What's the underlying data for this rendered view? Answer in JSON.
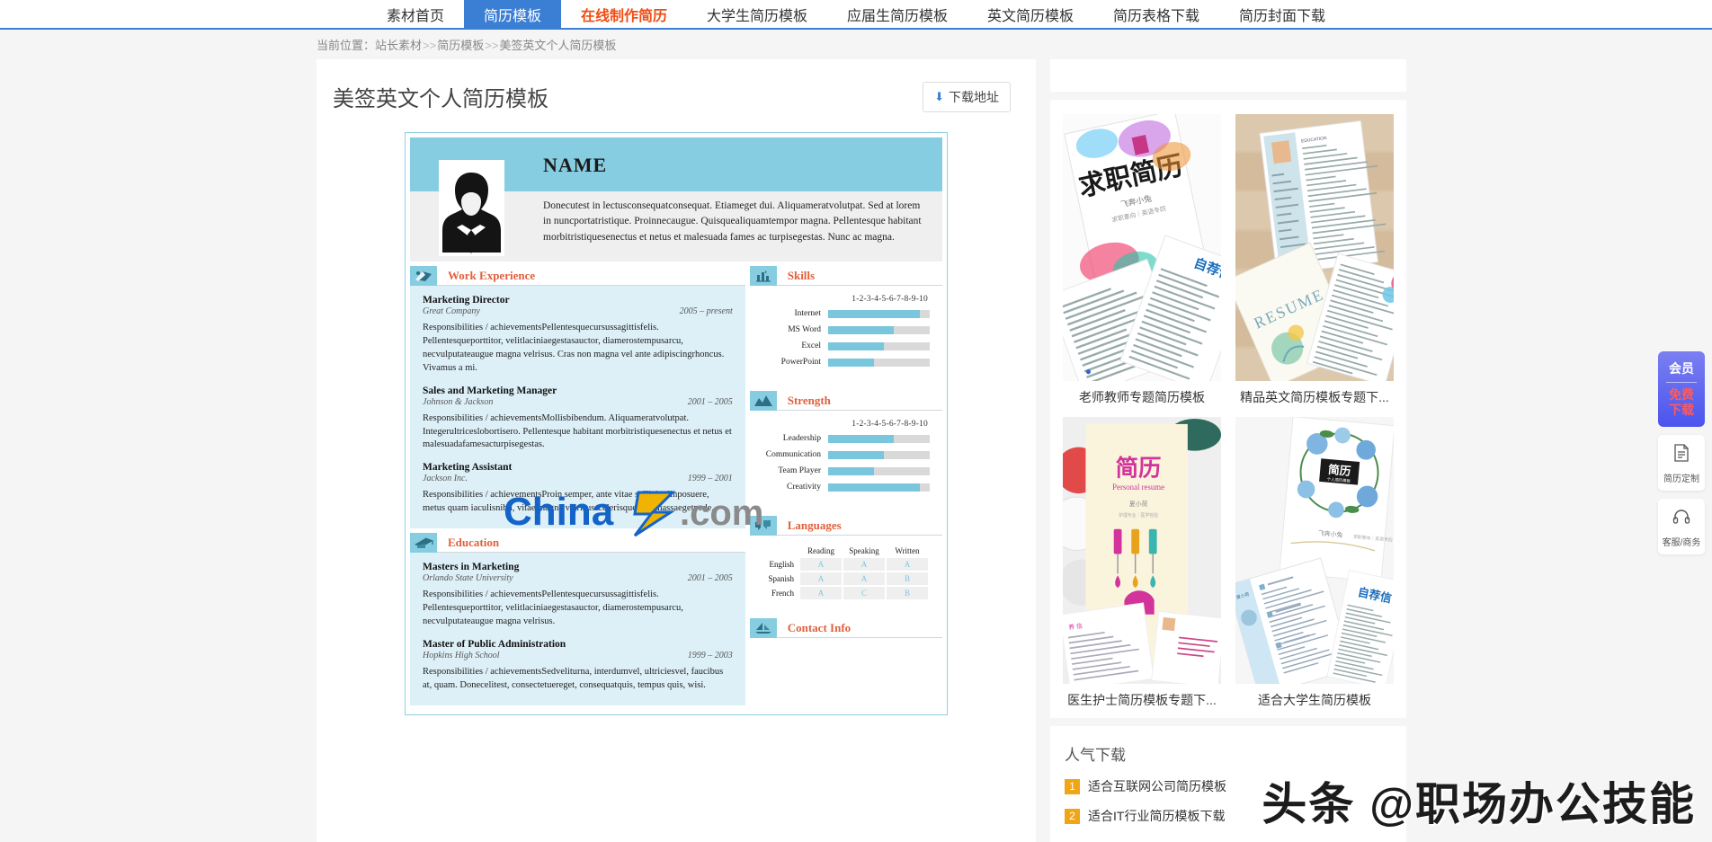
{
  "nav": {
    "items": [
      {
        "label": "素材首页",
        "state": "normal"
      },
      {
        "label": "简历模板",
        "state": "active"
      },
      {
        "label": "在线制作简历",
        "state": "hot"
      },
      {
        "label": "大学生简历模板",
        "state": "normal"
      },
      {
        "label": "应届生简历模板",
        "state": "normal"
      },
      {
        "label": "英文简历模板",
        "state": "normal"
      },
      {
        "label": "简历表格下载",
        "state": "normal"
      },
      {
        "label": "简历封面下载",
        "state": "normal"
      }
    ]
  },
  "breadcrumb": {
    "prefix": "当前位置：",
    "root": "站长素材",
    "sep1": ">>",
    "level2": "简历模板",
    "sep2": ">>",
    "current": "美签英文个人简历模板"
  },
  "header": {
    "title": "美签英文个人简历模板",
    "download_label": "下载地址",
    "download_icon": "download-arrow-icon"
  },
  "resume": {
    "name": "NAME",
    "summary": "Donecutest in lectusconsequatconsequat. Etiameget dui. Aliquameratvolutpat. Sed at lorem in nuncportatristique. Proinnecaugue. Quisquealiquamtempor magna. Pellentesque habitant morbitristiquesenectus et netus et malesuada fames ac turpisegestas. Nunc ac magna.",
    "work": {
      "title": "Work Experience",
      "icon": "briefcase-icon",
      "jobs": [
        {
          "title": "Marketing Director",
          "org": "Great Company",
          "period": "2005 – present",
          "desc": "Responsibilities / achievementsPellentesquecursussagittisfelis. Pellentesqueporttitor, velitlaciniaegestasauctor, diamerostempusarcu, necvulputateaugue magna velrisus. Cras non magna vel ante adipiscingrhoncus. Vivamus a mi."
        },
        {
          "title": "Sales and Marketing Manager",
          "org": "Johnson & Jackson",
          "period": "2001 – 2005",
          "desc": "Responsibilities / achievementsMollisbibendum. Aliquameratvolutpat. Integerultriceslobortisero. Pellentesque habitant morbitristiquesenectus et netus et malesuadafamesacturpisegestas."
        },
        {
          "title": "Marketing Assistant",
          "org": "Jackson Inc.",
          "period": "1999 – 2001",
          "desc": "Responsibilities / achievementsProin semper, ante vitae sollicitudinposuere, metus quam iaculisnibh, vitae magna velrisusscelerisquenuncmassaegetpede."
        }
      ]
    },
    "education": {
      "title": "Education",
      "icon": "graduation-icon",
      "items": [
        {
          "title": "Masters in Marketing",
          "org": "Orlando State University",
          "period": "2001 – 2005",
          "desc": "Responsibilities / achievementsPellentesquecursussagittisfelis. Pellentesqueporttitor, velitlaciniaegestasauctor, diamerostempusarcu, necvulputateaugue magna velrisus."
        },
        {
          "title": "Master of Public Administration",
          "org": "Hopkins High School",
          "period": "1999 – 2003",
          "desc": "Responsibilities / achievementsSedveliturna, interdumvel, ultriciesvel, faucibus at, quam. Donecelitest, consectetuereget, consequatquis, tempus quis, wisi."
        }
      ]
    },
    "skills": {
      "title": "Skills",
      "icon": "chart-bars-icon",
      "scale": "1-2-3-4-5-6-7-8-9-10",
      "items": [
        {
          "label": "Internet",
          "value": 9
        },
        {
          "label": "MS Word",
          "value": 6.5
        },
        {
          "label": "Excel",
          "value": 5.5
        },
        {
          "label": "PowerPoint",
          "value": 4.5
        }
      ],
      "max": 10
    },
    "strength": {
      "title": "Strength",
      "icon": "mountain-icon",
      "scale": "1-2-3-4-5-6-7-8-9-10",
      "items": [
        {
          "label": "Leadership",
          "value": 6.5
        },
        {
          "label": "Communication",
          "value": 5.5
        },
        {
          "label": "Team Player",
          "value": 4.5
        },
        {
          "label": "Creativity",
          "value": 9
        }
      ],
      "max": 10
    },
    "languages": {
      "title": "Languages",
      "icon": "speech-bubble-icon",
      "columns": [
        "Reading",
        "Speaking",
        "Written"
      ],
      "rows": [
        {
          "name": "English",
          "grades": [
            "A",
            "A",
            "A"
          ]
        },
        {
          "name": "Spanish",
          "grades": [
            "A",
            "A",
            "B"
          ]
        },
        {
          "name": "French",
          "grades": [
            "A",
            "C",
            "B"
          ]
        }
      ]
    },
    "contact": {
      "title": "Contact Info",
      "icon": "sailboat-icon"
    }
  },
  "rail": {
    "thumbs": [
      {
        "caption": "老师教师专题简历模板",
        "art": "watercolor"
      },
      {
        "caption": "精品英文简历模板专题下...",
        "art": "wood"
      },
      {
        "caption": "医生护士简历模板专题下...",
        "art": "medical"
      },
      {
        "caption": "适合大学生简历模板",
        "art": "floral"
      }
    ],
    "popular": {
      "title": "人气下载",
      "items": [
        {
          "rank": "1",
          "label": "适合互联网公司简历模板"
        },
        {
          "rank": "2",
          "label": "适合IT行业简历模板下载"
        }
      ]
    }
  },
  "floating": {
    "vip": {
      "top": "会员",
      "bottom_line1": "免费",
      "bottom_line2": "下载"
    },
    "tools": [
      {
        "label": "简历定制",
        "icon": "document-list-icon"
      },
      {
        "label": "客服/商务",
        "icon": "headset-icon"
      }
    ]
  },
  "watermarks": {
    "center": "China.com",
    "bottom": "头条 @职场办公技能"
  },
  "colors": {
    "nav_active": "#3b7fd4",
    "nav_hot": "#f04c14",
    "resume_accent": "#87cde1",
    "resume_heading": "#e0603c",
    "resume_body_bg": "#ddf0f8",
    "bar_fill": "#79c6dd",
    "bar_track": "#d9d9d9",
    "rank_badge": "#f0a516",
    "vip_gradient_start": "#7b7ff0",
    "vip_gradient_end": "#4b54ee",
    "vip_text_red": "#ff5a5a"
  }
}
